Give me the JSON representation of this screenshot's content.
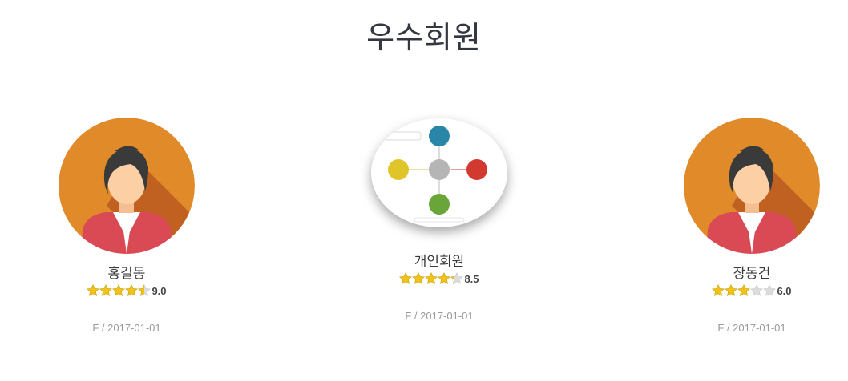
{
  "section": {
    "title": "우수회원"
  },
  "members": [
    {
      "name": "홍길동",
      "score": "9.0",
      "rating": 4.5,
      "date": "F / 2017-01-01",
      "image": "female-avatar-icon"
    },
    {
      "name": "개인회원",
      "score": "8.5",
      "rating": 4.25,
      "date": "F / 2017-01-01",
      "image": "brand-diagram-thumbnail"
    },
    {
      "name": "장동건",
      "score": "6.0",
      "rating": 3,
      "date": "F / 2017-01-01",
      "image": "female-avatar-icon"
    }
  ],
  "colors": {
    "avatar_bg": "#e08a2a",
    "avatar_shadow": "#b55a1f",
    "jacket": "#d94a55",
    "hair": "#3a3a3a",
    "skin": "#fcd0a4",
    "star_filled": "#f2c315",
    "star_empty": "#dcdcdc"
  }
}
